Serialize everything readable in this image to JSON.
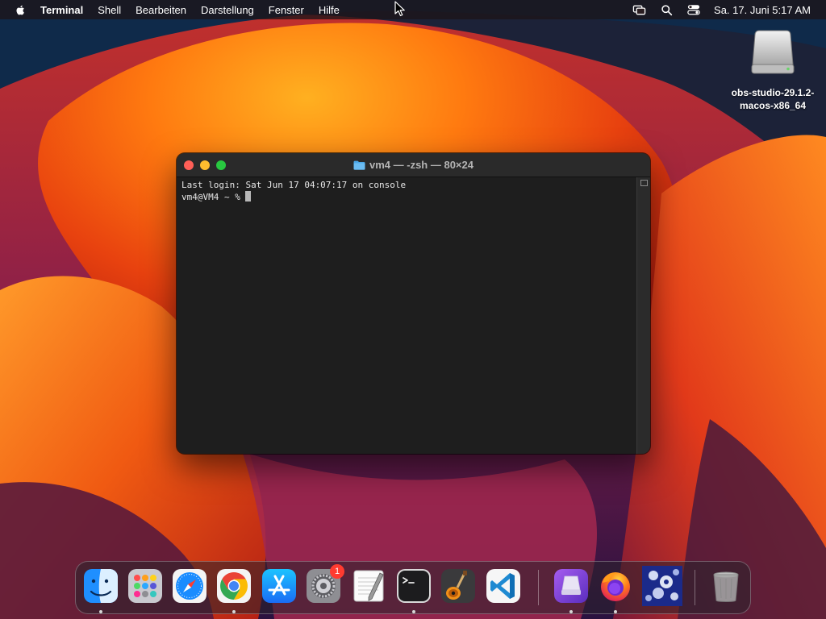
{
  "menubar": {
    "app_name": "Terminal",
    "items": [
      "Shell",
      "Bearbeiten",
      "Darstellung",
      "Fenster",
      "Hilfe"
    ],
    "clock": "Sa. 17. Juni  5:17 AM",
    "status_icons": [
      "screen-mirroring-icon",
      "search-icon",
      "control-center-icon"
    ]
  },
  "desktop": {
    "icons": [
      {
        "label": "obs-studio-29.1.2-macos-x86_64",
        "icon": "disk-image-icon"
      }
    ]
  },
  "terminal": {
    "title": "vm4 — -zsh — 80×24",
    "lines": [
      "Last login: Sat Jun 17 04:07:17 on console"
    ],
    "prompt": "vm4@VM4 ~ % "
  },
  "dock": {
    "items": [
      {
        "name": "finder",
        "running": true
      },
      {
        "name": "launchpad",
        "running": false
      },
      {
        "name": "safari",
        "running": false
      },
      {
        "name": "chrome",
        "running": true
      },
      {
        "name": "app-store",
        "running": false
      },
      {
        "name": "system-settings",
        "running": false,
        "badge": "1"
      },
      {
        "name": "textedit",
        "running": false
      },
      {
        "name": "terminal",
        "running": true
      },
      {
        "name": "garageband",
        "running": false
      },
      {
        "name": "vscode",
        "running": false
      },
      {
        "name": "disk-image-utility",
        "running": true
      },
      {
        "name": "firefox",
        "running": true
      },
      {
        "name": "fractal-image",
        "running": false
      },
      {
        "name": "trash",
        "running": false
      }
    ]
  },
  "colors": {
    "traffic_close": "#ff5f57",
    "traffic_min": "#febc2e",
    "traffic_max": "#28c840",
    "terminal_bg": "#1e1e1e"
  }
}
